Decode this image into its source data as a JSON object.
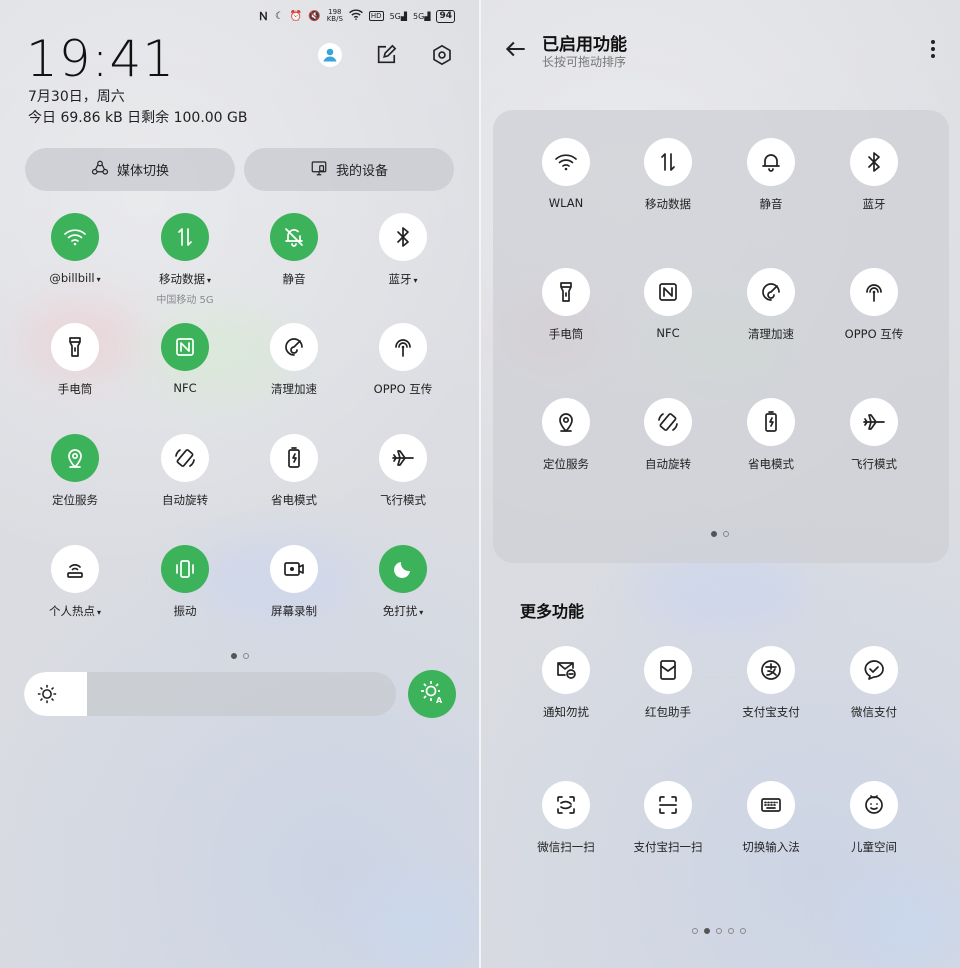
{
  "left": {
    "status_bar": {
      "icons": [
        "nfc-icon",
        "moon-icon",
        "alarm-icon",
        "mute-icon"
      ],
      "net_speed_top": "198",
      "net_speed_bottom": "KB/S",
      "hd": "HD",
      "signal1": "5G",
      "signal2": "5G",
      "battery": "94"
    },
    "clock": "19:41",
    "date": "7月30日，周六",
    "data_usage": "今日 69.86 kB 日剩余 100.00 GB",
    "top_icons": [
      "user-icon",
      "edit-icon",
      "settings-icon"
    ],
    "pills": [
      {
        "label": "媒体切换",
        "icon": "media-switch-icon"
      },
      {
        "label": "我的设备",
        "icon": "devices-icon"
      }
    ],
    "tiles": [
      {
        "label": "@billbill",
        "caret": "▾",
        "sub": "",
        "icon": "wifi-icon",
        "on": true
      },
      {
        "label": "移动数据",
        "caret": "▾",
        "sub": "中国移动 5G",
        "icon": "mobile-data-icon",
        "on": true
      },
      {
        "label": "静音",
        "caret": "",
        "sub": "",
        "icon": "bell-off-icon",
        "on": true
      },
      {
        "label": "蓝牙",
        "caret": "▾",
        "sub": "",
        "icon": "bluetooth-icon",
        "on": false
      },
      {
        "label": "手电筒",
        "caret": "",
        "sub": "",
        "icon": "flashlight-icon",
        "on": false
      },
      {
        "label": "NFC",
        "caret": "",
        "sub": "",
        "icon": "nfc-icon",
        "on": true
      },
      {
        "label": "清理加速",
        "caret": "",
        "sub": "",
        "icon": "boost-icon",
        "on": false
      },
      {
        "label": "OPPO 互传",
        "caret": "",
        "sub": "",
        "icon": "share-icon",
        "on": false
      },
      {
        "label": "定位服务",
        "caret": "",
        "sub": "",
        "icon": "location-icon",
        "on": true
      },
      {
        "label": "自动旋转",
        "caret": "",
        "sub": "",
        "icon": "rotate-icon",
        "on": false
      },
      {
        "label": "省电模式",
        "caret": "",
        "sub": "",
        "icon": "battery-saver-icon",
        "on": false
      },
      {
        "label": "飞行模式",
        "caret": "",
        "sub": "",
        "icon": "airplane-icon",
        "on": false
      },
      {
        "label": "个人热点",
        "caret": "▾",
        "sub": "",
        "icon": "hotspot-icon",
        "on": false
      },
      {
        "label": "振动",
        "caret": "",
        "sub": "",
        "icon": "vibrate-icon",
        "on": true
      },
      {
        "label": "屏幕录制",
        "caret": "",
        "sub": "",
        "icon": "screen-record-icon",
        "on": false
      },
      {
        "label": "免打扰",
        "caret": "▾",
        "sub": "",
        "icon": "moon-icon",
        "on": true
      }
    ],
    "page_dots": {
      "count": 2,
      "active": 0
    },
    "brightness": {
      "level_percent": 17
    }
  },
  "right": {
    "title": "已启用功能",
    "subtitle": "长按可拖动排序",
    "enabled": [
      {
        "label": "WLAN",
        "icon": "wifi-icon"
      },
      {
        "label": "移动数据",
        "icon": "mobile-data-icon"
      },
      {
        "label": "静音",
        "icon": "bell-icon"
      },
      {
        "label": "蓝牙",
        "icon": "bluetooth-icon"
      },
      {
        "label": "手电筒",
        "icon": "flashlight-icon"
      },
      {
        "label": "NFC",
        "icon": "nfc-icon"
      },
      {
        "label": "清理加速",
        "icon": "boost-icon"
      },
      {
        "label": "OPPO 互传",
        "icon": "share-icon"
      },
      {
        "label": "定位服务",
        "icon": "location-icon"
      },
      {
        "label": "自动旋转",
        "icon": "rotate-icon"
      },
      {
        "label": "省电模式",
        "icon": "battery-saver-icon"
      },
      {
        "label": "飞行模式",
        "icon": "airplane-icon"
      }
    ],
    "enabled_dots": {
      "count": 2,
      "active": 0
    },
    "more_title": "更多功能",
    "more": [
      {
        "label": "通知勿扰",
        "icon": "notification-dnd-icon"
      },
      {
        "label": "红包助手",
        "icon": "red-envelope-icon"
      },
      {
        "label": "支付宝支付",
        "icon": "alipay-icon"
      },
      {
        "label": "微信支付",
        "icon": "wechat-pay-icon"
      },
      {
        "label": "微信扫一扫",
        "icon": "wechat-scan-icon"
      },
      {
        "label": "支付宝扫一扫",
        "icon": "alipay-scan-icon"
      },
      {
        "label": "切换输入法",
        "icon": "keyboard-icon"
      },
      {
        "label": "儿童空间",
        "icon": "kid-icon"
      }
    ],
    "more_dots": {
      "count": 5,
      "active": 1
    }
  },
  "colors": {
    "accent": "#3cb35a",
    "tile_off": "#ffffff",
    "panel": "#dcdee2"
  }
}
